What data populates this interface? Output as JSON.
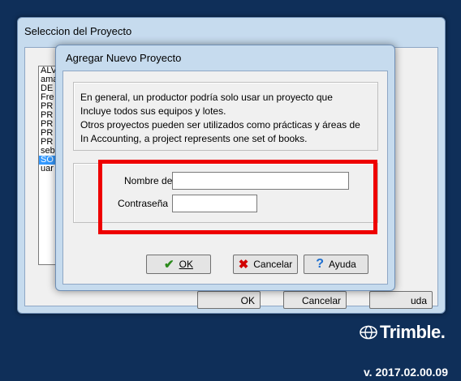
{
  "back_window": {
    "title": "Seleccion del Proyecto",
    "projects": [
      "ALV",
      "ama",
      "DE",
      "Fre",
      "PR",
      "PR",
      "PR",
      "PR",
      "PR",
      "seb",
      "SO",
      "uar"
    ],
    "selected_index": 10,
    "buttons": {
      "ok": "OK",
      "cancel": "Cancelar",
      "help": "Ayuda"
    },
    "visible_fragment": "uda"
  },
  "dialog": {
    "title": "Agregar Nuevo Proyecto",
    "info_lines": [
      "En general, un productor podría solo usar un proyecto que",
      "Incluye todos sus equipos y lotes.",
      "Otros proyectos pueden ser utilizados como prácticas y áreas de",
      "In Accounting, a project represents one set of books."
    ],
    "name_label": "Nombre del",
    "name_value": "",
    "password_label": "Contraseña",
    "password_value": "",
    "ok_label": "OK",
    "cancel_label": "Cancelar",
    "help_label": "Ayuda"
  },
  "brand": {
    "name": "Trimble.",
    "version": "v. 2017.02.00.09"
  },
  "colors": {
    "background": "#0f2f59",
    "highlight": "#ee0000"
  }
}
